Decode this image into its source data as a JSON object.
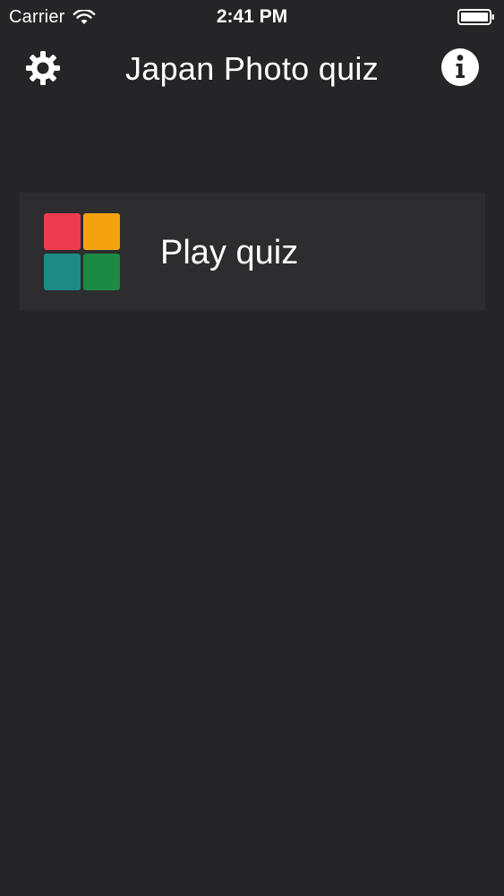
{
  "status_bar": {
    "carrier": "Carrier",
    "time": "2:41 PM"
  },
  "nav": {
    "title": "Japan Photo quiz",
    "left_icon": "gear-icon",
    "right_icon": "info-icon"
  },
  "menu": {
    "items": [
      {
        "label": "Play quiz",
        "icon": "quiz-grid-icon",
        "tile_colors": [
          "#ee3b4f",
          "#f4a30f",
          "#1d8a86",
          "#1b8a44"
        ]
      }
    ]
  },
  "colors": {
    "background": "#252426",
    "card": "#2d2c2e",
    "text": "#ffffff"
  }
}
